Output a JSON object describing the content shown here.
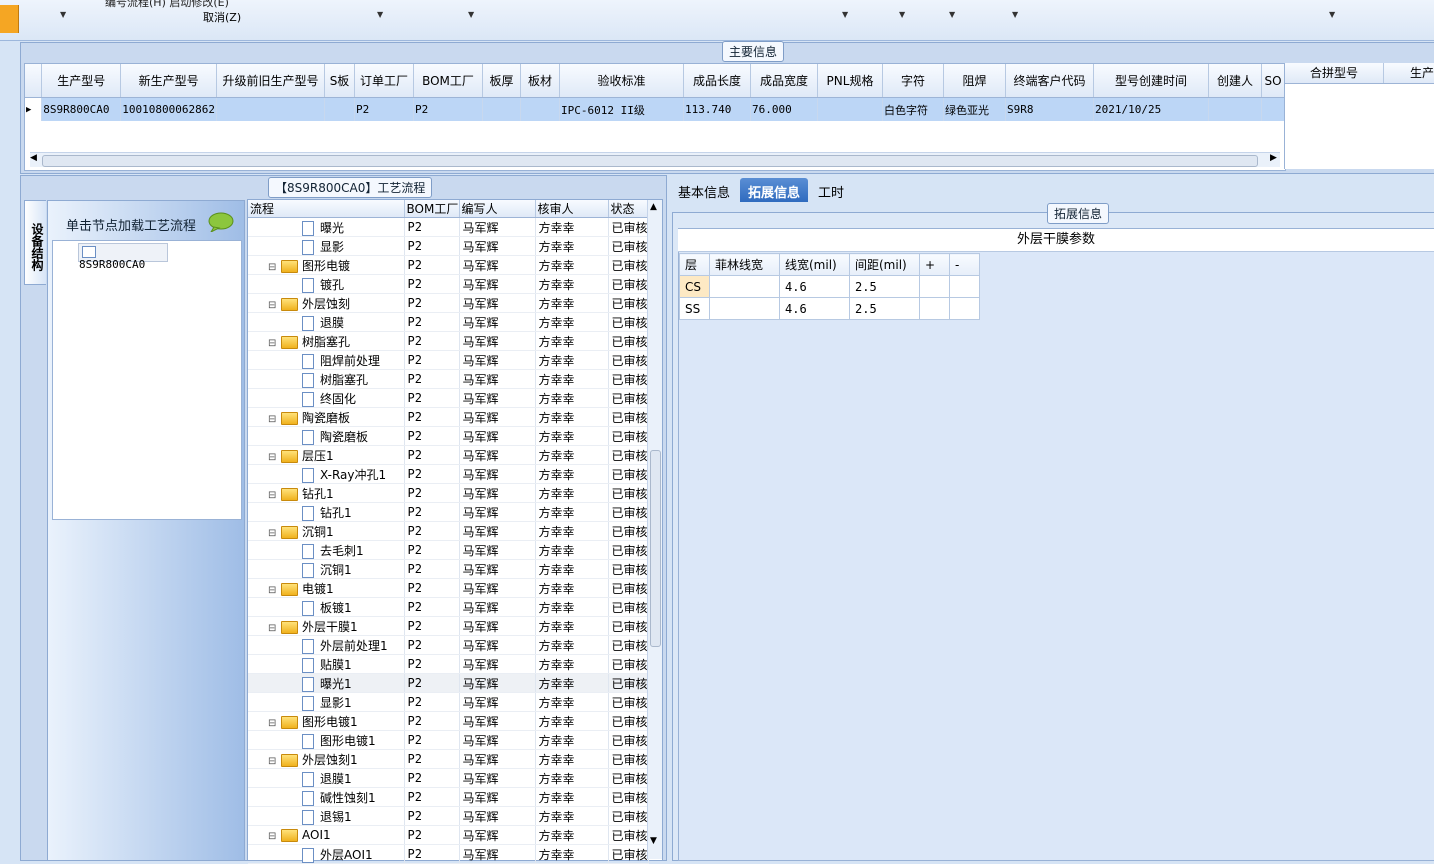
{
  "topbar": {
    "menu_partial": "编号流程(H)    启动修改(E)",
    "cancel": "取消(Z)"
  },
  "main_info": {
    "legend": "主要信息",
    "columns": [
      "生产型号",
      "新生产型号",
      "升级前旧生产型号",
      "S板",
      "订单工厂",
      "BOM工厂",
      "板厚",
      "板材",
      "验收标准",
      "成品长度",
      "成品宽度",
      "PNL规格",
      "字符",
      "阻焊",
      "终端客户代码",
      "型号创建时间",
      "创建人",
      "SO"
    ],
    "row": [
      "8S9R800CA0",
      "10010800062862",
      "",
      "",
      "P2",
      "P2",
      "",
      "",
      "IPC-6012 II级",
      "113.740",
      "76.000",
      "",
      "白色字符",
      "绿色亚光",
      "S9R8",
      "2021/10/25",
      "",
      ""
    ],
    "merge_columns": [
      "合拼型号",
      "生产"
    ]
  },
  "left_tab": "设备结构",
  "tree": {
    "load_label": "单击节点加载工艺流程",
    "node": "8S9R800CA0"
  },
  "flow": {
    "legend": "【8S9R800CA0】工艺流程",
    "columns": [
      "流程",
      "BOM工厂",
      "编写人",
      "核审人",
      "状态"
    ],
    "rows": [
      {
        "level": 2,
        "name": "曝光",
        "bom": "P2",
        "writer": "马军辉",
        "reviewer": "方幸幸",
        "status": "已审核"
      },
      {
        "level": 2,
        "name": "显影",
        "bom": "P2",
        "writer": "马军辉",
        "reviewer": "方幸幸",
        "status": "已审核"
      },
      {
        "level": 1,
        "name": "图形电镀",
        "bom": "P2",
        "writer": "马军辉",
        "reviewer": "方幸幸",
        "status": "已审核"
      },
      {
        "level": 2,
        "name": "镀孔",
        "bom": "P2",
        "writer": "马军辉",
        "reviewer": "方幸幸",
        "status": "已审核"
      },
      {
        "level": 1,
        "name": "外层蚀刻",
        "bom": "P2",
        "writer": "马军辉",
        "reviewer": "方幸幸",
        "status": "已审核"
      },
      {
        "level": 2,
        "name": "退膜",
        "bom": "P2",
        "writer": "马军辉",
        "reviewer": "方幸幸",
        "status": "已审核"
      },
      {
        "level": 1,
        "name": "树脂塞孔",
        "bom": "P2",
        "writer": "马军辉",
        "reviewer": "方幸幸",
        "status": "已审核"
      },
      {
        "level": 2,
        "name": "阻焊前处理",
        "bom": "P2",
        "writer": "马军辉",
        "reviewer": "方幸幸",
        "status": "已审核"
      },
      {
        "level": 2,
        "name": "树脂塞孔",
        "bom": "P2",
        "writer": "马军辉",
        "reviewer": "方幸幸",
        "status": "已审核"
      },
      {
        "level": 2,
        "name": "终固化",
        "bom": "P2",
        "writer": "马军辉",
        "reviewer": "方幸幸",
        "status": "已审核"
      },
      {
        "level": 1,
        "name": "陶瓷磨板",
        "bom": "P2",
        "writer": "马军辉",
        "reviewer": "方幸幸",
        "status": "已审核"
      },
      {
        "level": 2,
        "name": "陶瓷磨板",
        "bom": "P2",
        "writer": "马军辉",
        "reviewer": "方幸幸",
        "status": "已审核"
      },
      {
        "level": 1,
        "name": "层压1",
        "bom": "P2",
        "writer": "马军辉",
        "reviewer": "方幸幸",
        "status": "已审核"
      },
      {
        "level": 2,
        "name": "X-Ray冲孔1",
        "bom": "P2",
        "writer": "马军辉",
        "reviewer": "方幸幸",
        "status": "已审核"
      },
      {
        "level": 1,
        "name": "钻孔1",
        "bom": "P2",
        "writer": "马军辉",
        "reviewer": "方幸幸",
        "status": "已审核"
      },
      {
        "level": 2,
        "name": "钻孔1",
        "bom": "P2",
        "writer": "马军辉",
        "reviewer": "方幸幸",
        "status": "已审核"
      },
      {
        "level": 1,
        "name": "沉铜1",
        "bom": "P2",
        "writer": "马军辉",
        "reviewer": "方幸幸",
        "status": "已审核"
      },
      {
        "level": 2,
        "name": "去毛刺1",
        "bom": "P2",
        "writer": "马军辉",
        "reviewer": "方幸幸",
        "status": "已审核"
      },
      {
        "level": 2,
        "name": "沉铜1",
        "bom": "P2",
        "writer": "马军辉",
        "reviewer": "方幸幸",
        "status": "已审核"
      },
      {
        "level": 1,
        "name": "电镀1",
        "bom": "P2",
        "writer": "马军辉",
        "reviewer": "方幸幸",
        "status": "已审核"
      },
      {
        "level": 2,
        "name": "板镀1",
        "bom": "P2",
        "writer": "马军辉",
        "reviewer": "方幸幸",
        "status": "已审核"
      },
      {
        "level": 1,
        "name": "外层干膜1",
        "bom": "P2",
        "writer": "马军辉",
        "reviewer": "方幸幸",
        "status": "已审核"
      },
      {
        "level": 2,
        "name": "外层前处理1",
        "bom": "P2",
        "writer": "马军辉",
        "reviewer": "方幸幸",
        "status": "已审核"
      },
      {
        "level": 2,
        "name": "贴膜1",
        "bom": "P2",
        "writer": "马军辉",
        "reviewer": "方幸幸",
        "status": "已审核"
      },
      {
        "level": 2,
        "name": "曝光1",
        "bom": "P2",
        "writer": "马军辉",
        "reviewer": "方幸幸",
        "status": "已审核",
        "selected": true
      },
      {
        "level": 2,
        "name": "显影1",
        "bom": "P2",
        "writer": "马军辉",
        "reviewer": "方幸幸",
        "status": "已审核"
      },
      {
        "level": 1,
        "name": "图形电镀1",
        "bom": "P2",
        "writer": "马军辉",
        "reviewer": "方幸幸",
        "status": "已审核"
      },
      {
        "level": 2,
        "name": "图形电镀1",
        "bom": "P2",
        "writer": "马军辉",
        "reviewer": "方幸幸",
        "status": "已审核"
      },
      {
        "level": 1,
        "name": "外层蚀刻1",
        "bom": "P2",
        "writer": "马军辉",
        "reviewer": "方幸幸",
        "status": "已审核"
      },
      {
        "level": 2,
        "name": "退膜1",
        "bom": "P2",
        "writer": "马军辉",
        "reviewer": "方幸幸",
        "status": "已审核"
      },
      {
        "level": 2,
        "name": "碱性蚀刻1",
        "bom": "P2",
        "writer": "马军辉",
        "reviewer": "方幸幸",
        "status": "已审核"
      },
      {
        "level": 2,
        "name": "退锡1",
        "bom": "P2",
        "writer": "马军辉",
        "reviewer": "方幸幸",
        "status": "已审核"
      },
      {
        "level": 1,
        "name": "AOI1",
        "bom": "P2",
        "writer": "马军辉",
        "reviewer": "方幸幸",
        "status": "已审核"
      },
      {
        "level": 2,
        "name": "外层AOI1",
        "bom": "P2",
        "writer": "马军辉",
        "reviewer": "方幸幸",
        "status": "已审核"
      }
    ]
  },
  "right": {
    "tabs": [
      "基本信息",
      "拓展信息",
      "工时"
    ],
    "active_tab": "拓展信息",
    "legend": "拓展信息",
    "param_title": "外层干膜参数",
    "param_columns": [
      "层",
      "菲林线宽",
      "线宽(mil)",
      "间距(mil)",
      "+",
      "-"
    ],
    "param_rows": [
      [
        "CS",
        "",
        "4.6",
        "2.5",
        "",
        ""
      ],
      [
        "SS",
        "",
        "4.6",
        "2.5",
        "",
        ""
      ]
    ]
  }
}
